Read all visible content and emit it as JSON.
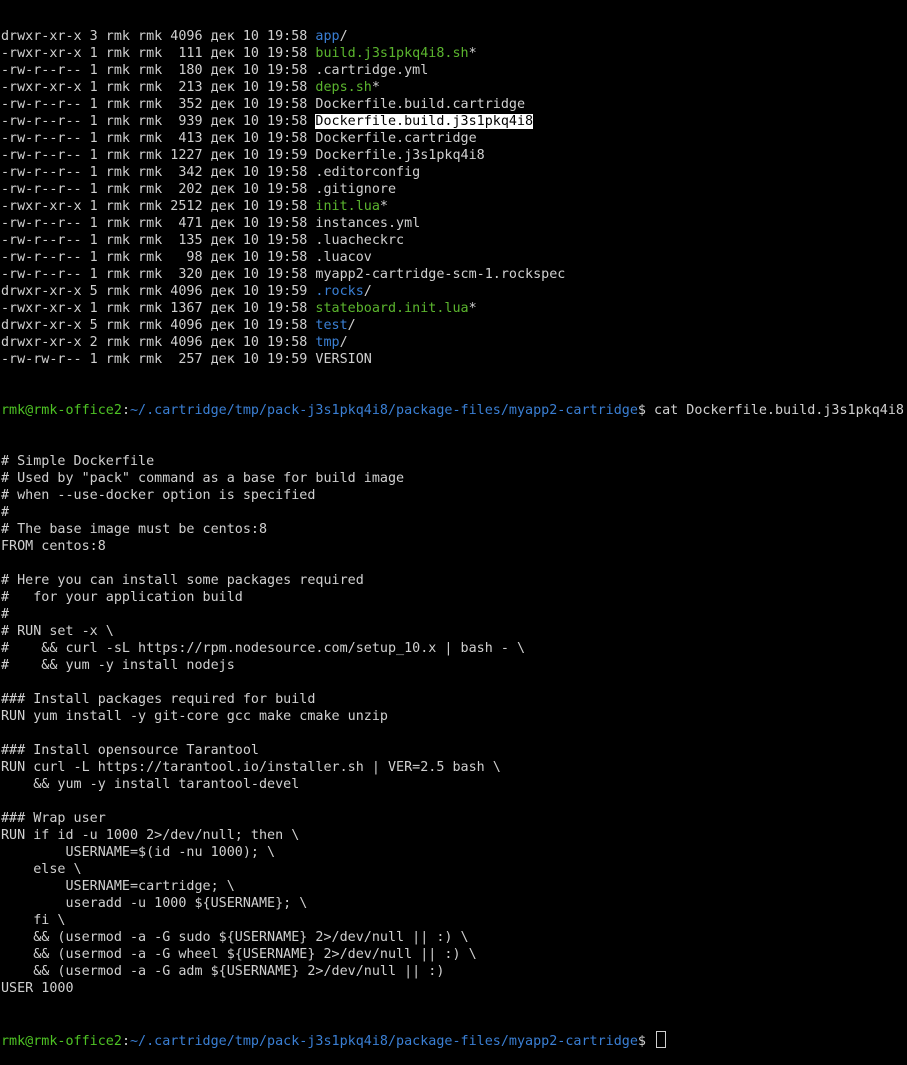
{
  "colors": {
    "background": "#000000",
    "text": "#d0d0d0",
    "directory": "#3a7fd4",
    "executable": "#5bb52e",
    "prompt_user": "#4ec324",
    "prompt_path": "#3a7fd4"
  },
  "listing": [
    {
      "meta": "drwxr-xr-x 3 rmk rmk 4096 дек 10 19:58 ",
      "name": "app",
      "kind": "dir",
      "suffix": "/"
    },
    {
      "meta": "-rwxr-xr-x 1 rmk rmk  111 дек 10 19:58 ",
      "name": "build.j3s1pkq4i8.sh",
      "kind": "exec",
      "suffix": "*"
    },
    {
      "meta": "-rw-r--r-- 1 rmk rmk  180 дек 10 19:58 ",
      "name": ".cartridge.yml",
      "kind": "file",
      "suffix": ""
    },
    {
      "meta": "-rwxr-xr-x 1 rmk rmk  213 дек 10 19:58 ",
      "name": "deps.sh",
      "kind": "exec",
      "suffix": "*"
    },
    {
      "meta": "-rw-r--r-- 1 rmk rmk  352 дек 10 19:58 ",
      "name": "Dockerfile.build.cartridge",
      "kind": "file",
      "suffix": ""
    },
    {
      "meta": "-rw-r--r-- 1 rmk rmk  939 дек 10 19:58 ",
      "name": "Dockerfile.build.j3s1pkq4i8",
      "kind": "selected",
      "suffix": ""
    },
    {
      "meta": "-rw-r--r-- 1 rmk rmk  413 дек 10 19:58 ",
      "name": "Dockerfile.cartridge",
      "kind": "file",
      "suffix": ""
    },
    {
      "meta": "-rw-r--r-- 1 rmk rmk 1227 дек 10 19:59 ",
      "name": "Dockerfile.j3s1pkq4i8",
      "kind": "file",
      "suffix": ""
    },
    {
      "meta": "-rw-r--r-- 1 rmk rmk  342 дек 10 19:58 ",
      "name": ".editorconfig",
      "kind": "file",
      "suffix": ""
    },
    {
      "meta": "-rw-r--r-- 1 rmk rmk  202 дек 10 19:58 ",
      "name": ".gitignore",
      "kind": "file",
      "suffix": ""
    },
    {
      "meta": "-rwxr-xr-x 1 rmk rmk 2512 дек 10 19:58 ",
      "name": "init.lua",
      "kind": "exec",
      "suffix": "*"
    },
    {
      "meta": "-rw-r--r-- 1 rmk rmk  471 дек 10 19:58 ",
      "name": "instances.yml",
      "kind": "file",
      "suffix": ""
    },
    {
      "meta": "-rw-r--r-- 1 rmk rmk  135 дек 10 19:58 ",
      "name": ".luacheckrc",
      "kind": "file",
      "suffix": ""
    },
    {
      "meta": "-rw-r--r-- 1 rmk rmk   98 дек 10 19:58 ",
      "name": ".luacov",
      "kind": "file",
      "suffix": ""
    },
    {
      "meta": "-rw-r--r-- 1 rmk rmk  320 дек 10 19:58 ",
      "name": "myapp2-cartridge-scm-1.rockspec",
      "kind": "file",
      "suffix": ""
    },
    {
      "meta": "drwxr-xr-x 5 rmk rmk 4096 дек 10 19:59 ",
      "name": ".rocks",
      "kind": "dir",
      "suffix": "/"
    },
    {
      "meta": "-rwxr-xr-x 1 rmk rmk 1367 дек 10 19:58 ",
      "name": "stateboard.init.lua",
      "kind": "exec",
      "suffix": "*"
    },
    {
      "meta": "drwxr-xr-x 5 rmk rmk 4096 дек 10 19:58 ",
      "name": "test",
      "kind": "dir",
      "suffix": "/"
    },
    {
      "meta": "drwxr-xr-x 2 rmk rmk 4096 дек 10 19:58 ",
      "name": "tmp",
      "kind": "dir",
      "suffix": "/"
    },
    {
      "meta": "-rw-rw-r-- 1 rmk rmk  257 дек 10 19:59 ",
      "name": "VERSION",
      "kind": "file",
      "suffix": ""
    }
  ],
  "prompt": {
    "user_host": "rmk@rmk-office2",
    "path": "~/.cartridge/tmp/pack-j3s1pkq4i8/package-files/myapp2-cartridge",
    "symbol": "$ ",
    "command": "cat Dockerfile.build.j3s1pkq4i8"
  },
  "file_lines": [
    "# Simple Dockerfile",
    "# Used by \"pack\" command as a base for build image",
    "# when --use-docker option is specified",
    "#",
    "# The base image must be centos:8",
    "FROM centos:8",
    "",
    "# Here you can install some packages required",
    "#   for your application build",
    "#",
    "# RUN set -x \\",
    "#    && curl -sL https://rpm.nodesource.com/setup_10.x | bash - \\",
    "#    && yum -y install nodejs",
    "",
    "### Install packages required for build",
    "RUN yum install -y git-core gcc make cmake unzip",
    "",
    "### Install opensource Tarantool",
    "RUN curl -L https://tarantool.io/installer.sh | VER=2.5 bash \\",
    "    && yum -y install tarantool-devel",
    "",
    "### Wrap user",
    "RUN if id -u 1000 2>/dev/null; then \\",
    "        USERNAME=$(id -nu 1000); \\",
    "    else \\",
    "        USERNAME=cartridge; \\",
    "        useradd -u 1000 ${USERNAME}; \\",
    "    fi \\",
    "    && (usermod -a -G sudo ${USERNAME} 2>/dev/null || :) \\",
    "    && (usermod -a -G wheel ${USERNAME} 2>/dev/null || :) \\",
    "    && (usermod -a -G adm ${USERNAME} 2>/dev/null || :)",
    "USER 1000"
  ],
  "final_prompt": {
    "user_host": "rmk@rmk-office2",
    "path": "~/.cartridge/tmp/pack-j3s1pkq4i8/package-files/myapp2-cartridge",
    "symbol": "$ "
  }
}
